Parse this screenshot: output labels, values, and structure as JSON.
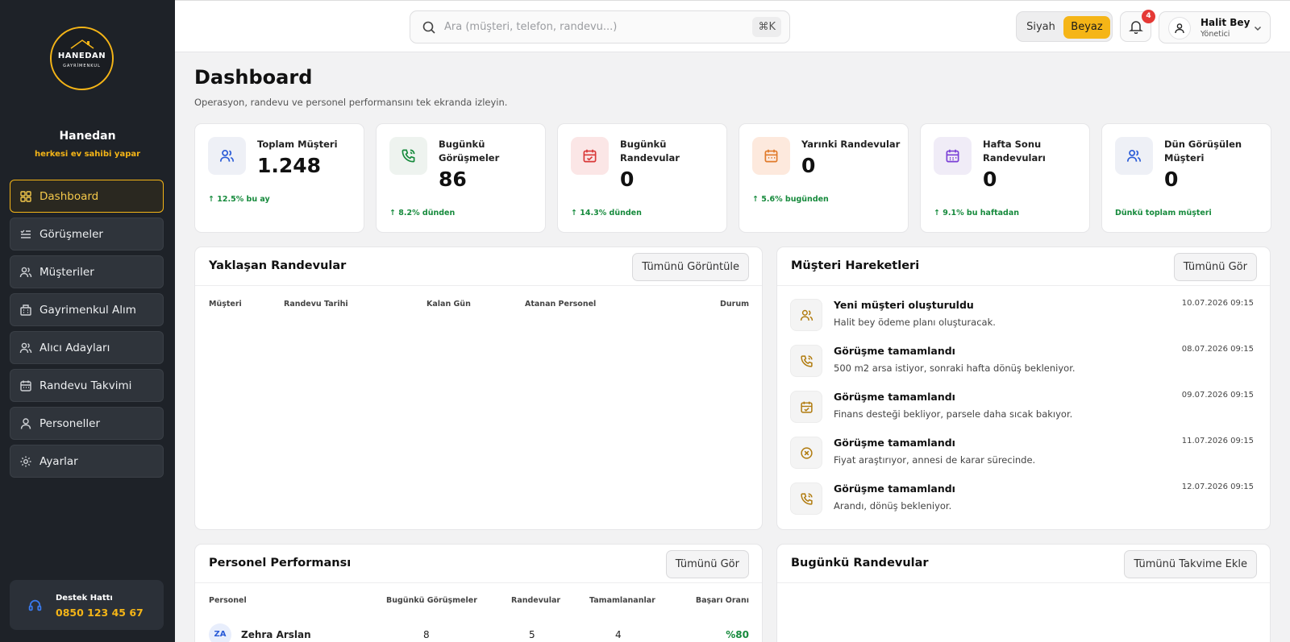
{
  "brand": {
    "logo_main": "HANEDAN",
    "logo_sub": "GAYRİMENKUL",
    "name": "Hanedan",
    "tagline": "herkesi ev sahibi yapar"
  },
  "sidebar": {
    "items": [
      {
        "label": "Dashboard",
        "icon": "dashboard-icon"
      },
      {
        "label": "Görüşmeler",
        "icon": "list-check-icon"
      },
      {
        "label": "Müşteriler",
        "icon": "users-icon"
      },
      {
        "label": "Gayrimenkul Alım",
        "icon": "building-icon"
      },
      {
        "label": "Alıcı Adayları",
        "icon": "users-icon"
      },
      {
        "label": "Randevu Takvimi",
        "icon": "calendar-icon"
      },
      {
        "label": "Personeller",
        "icon": "user-icon"
      },
      {
        "label": "Ayarlar",
        "icon": "gear-icon"
      }
    ],
    "support": {
      "label": "Destek Hattı",
      "phone": "0850 123 45 67"
    }
  },
  "topbar": {
    "search_placeholder": "Ara (müşteri, telefon, randevu...)",
    "shortcut": "⌘K",
    "theme_dark": "Siyah",
    "theme_light": "Beyaz",
    "notifications": "4",
    "user_name": "Halit Bey",
    "user_role": "Yönetici"
  },
  "header": {
    "title": "Dashboard",
    "subtitle": "Operasyon, randevu ve personel performansını tek ekranda izleyin."
  },
  "stats": [
    {
      "label": "Toplam Müşteri",
      "value": "1.248",
      "trend": "↑ 12.5% bu ay",
      "color": "#2a5bd7"
    },
    {
      "label": "Bugünkü Görüşmeler",
      "value": "86",
      "trend": "↑ 8.2% dünden",
      "color": "#168a3c"
    },
    {
      "label": "Bugünkü Randevular",
      "value": "0",
      "trend": "↑ 14.3% dünden",
      "color": "#d93838"
    },
    {
      "label": "Yarınki Randevular",
      "value": "0",
      "trend": "↑ 5.6% bugünden",
      "color": "#e07a2a"
    },
    {
      "label": "Hafta Sonu Randevuları",
      "value": "0",
      "trend": "↑ 9.1% bu haftadan",
      "color": "#7a3fd6"
    },
    {
      "label": "Dün Görüşülen Müşteri",
      "value": "0",
      "trend": "Dünkü toplam müşteri",
      "color": "#2a5bd7"
    }
  ],
  "upcoming": {
    "title": "Yaklaşan Randevular",
    "button": "Tümünü Görüntüle",
    "columns": [
      "Müşteri",
      "Randevu Tarihi",
      "Kalan Gün",
      "Atanan Personel",
      "Durum"
    ]
  },
  "activity": {
    "title": "Müşteri Hareketleri",
    "button": "Tümünü Gör",
    "items": [
      {
        "title": "Yeni müşteri oluşturuldu",
        "desc": "Halit bey ödeme planı oluşturacak.",
        "date": "10.07.2026 09:15",
        "icon": "users-icon"
      },
      {
        "title": "Görüşme tamamlandı",
        "desc": "500 m2 arsa istiyor, sonraki hafta dönüş bekleniyor.",
        "date": "08.07.2026 09:15",
        "icon": "phone-icon"
      },
      {
        "title": "Görüşme tamamlandı",
        "desc": "Finans desteği bekliyor, parsele daha sıcak bakıyor.",
        "date": "09.07.2026 09:15",
        "icon": "calendar-check-icon"
      },
      {
        "title": "Görüşme tamamlandı",
        "desc": "Fiyat araştırıyor, annesi de karar sürecinde.",
        "date": "11.07.2026 09:15",
        "icon": "x-circle-icon"
      },
      {
        "title": "Görüşme tamamlandı",
        "desc": "Arandı, dönüş bekleniyor.",
        "date": "12.07.2026 09:15",
        "icon": "phone-icon"
      }
    ]
  },
  "performance": {
    "title": "Personel Performansı",
    "button": "Tümünü Gör",
    "columns": [
      "Personel",
      "Bugünkü Görüşmeler",
      "Randevular",
      "Tamamlananlar",
      "Başarı Oranı"
    ],
    "rows": [
      {
        "initials": "ZA",
        "name": "Zehra Arslan",
        "calls": "8",
        "appointments": "5",
        "completed": "4",
        "rate": "%80"
      }
    ]
  },
  "today": {
    "title": "Bugünkü Randevular",
    "button": "Tümünü Takvime Ekle"
  }
}
